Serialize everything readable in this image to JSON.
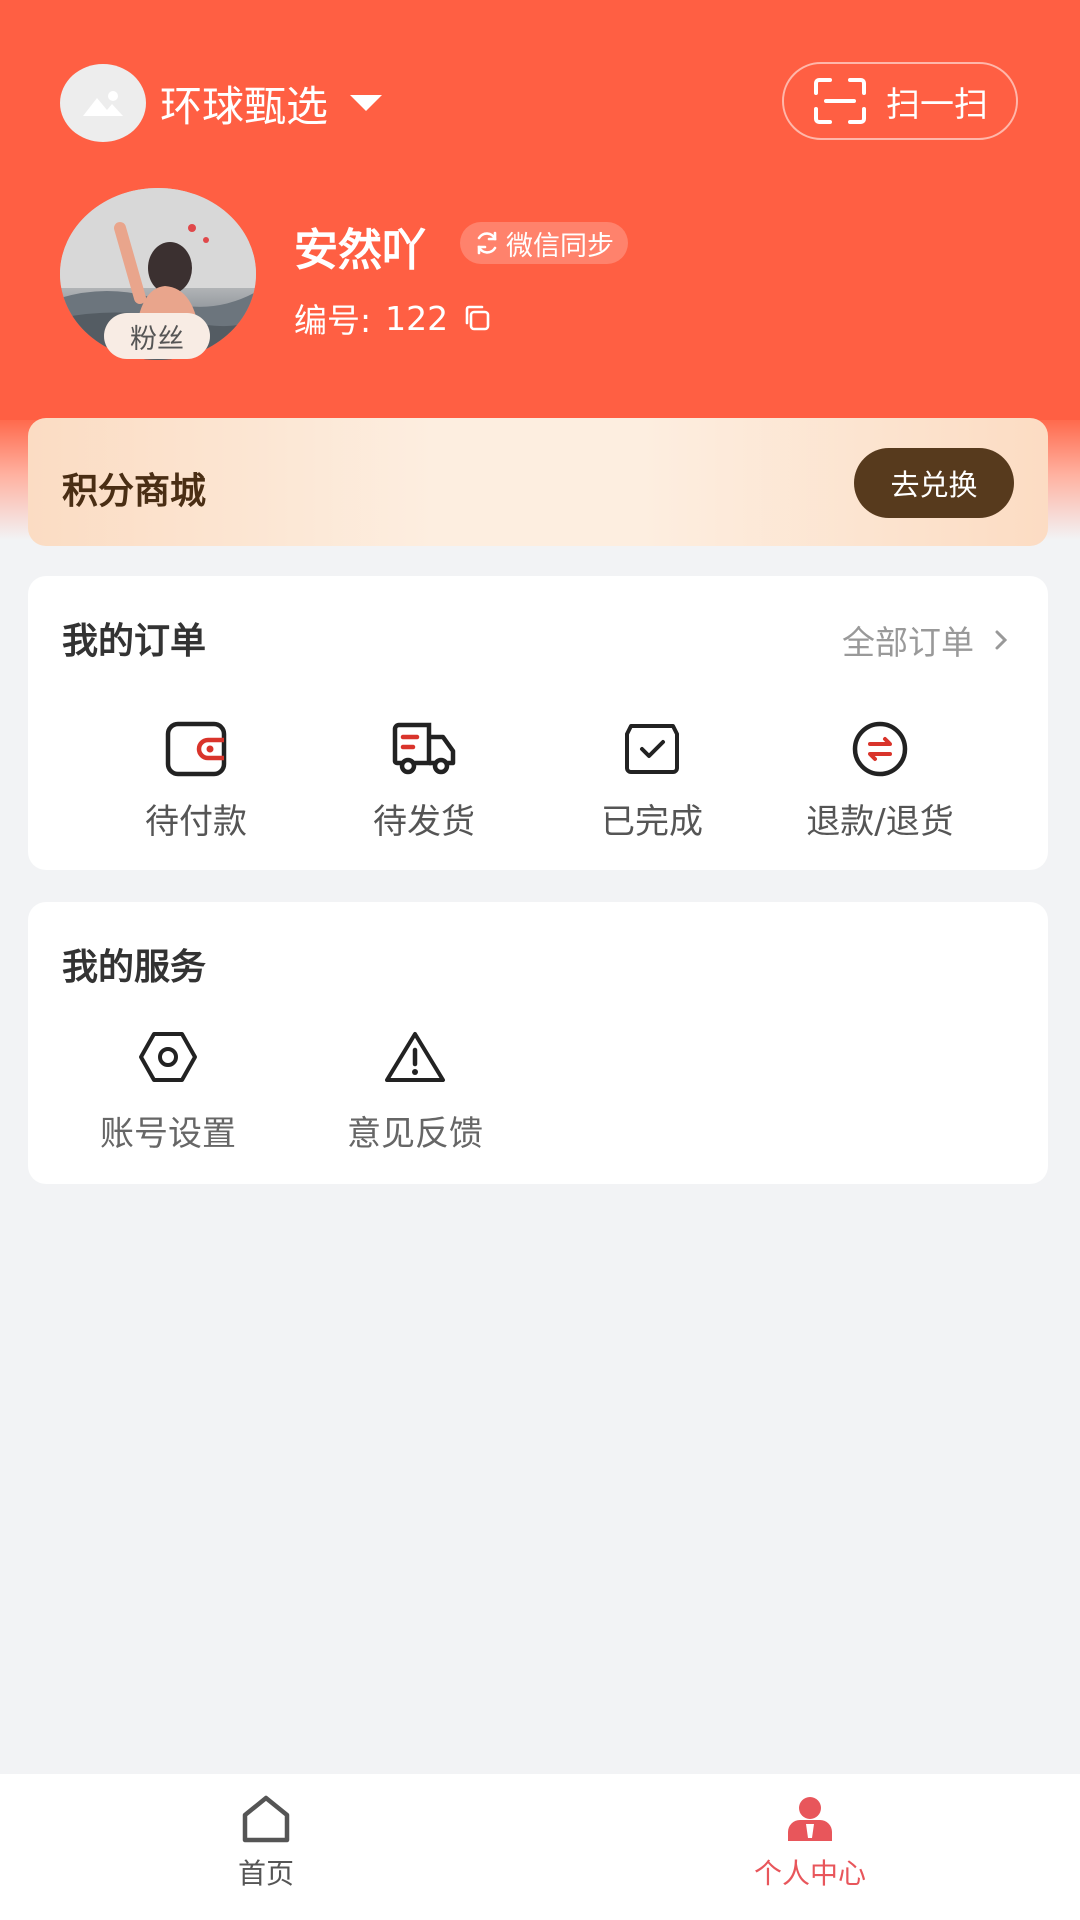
{
  "header": {
    "shop_name": "环球甄选",
    "scan_label": "扫一扫"
  },
  "profile": {
    "nickname": "安然吖",
    "sync_label": "微信同步",
    "member_label": "编号:",
    "member_id": "122",
    "badge": "粉丝"
  },
  "points_mall": {
    "title": "积分商城",
    "button": "去兑换"
  },
  "orders": {
    "title": "我的订单",
    "all_link": "全部订单",
    "items": [
      {
        "label": "待付款",
        "icon": "wallet-icon"
      },
      {
        "label": "待发货",
        "icon": "delivery-truck-icon"
      },
      {
        "label": "已完成",
        "icon": "completed-box-icon"
      },
      {
        "label": "退款/退货",
        "icon": "refund-exchange-icon"
      }
    ]
  },
  "services": {
    "title": "我的服务",
    "items": [
      {
        "label": "账号设置",
        "icon": "settings-hexagon-icon"
      },
      {
        "label": "意见反馈",
        "icon": "warning-triangle-icon"
      }
    ]
  },
  "tabbar": {
    "items": [
      {
        "label": "首页",
        "icon": "home-icon",
        "active": false
      },
      {
        "label": "个人中心",
        "icon": "user-icon",
        "active": true
      }
    ],
    "active_color": "#e8565b",
    "inactive_color": "#555555"
  },
  "colors": {
    "header": "#ff5f43",
    "points_button": "#573a1d",
    "accent_red": "#d9342b"
  }
}
